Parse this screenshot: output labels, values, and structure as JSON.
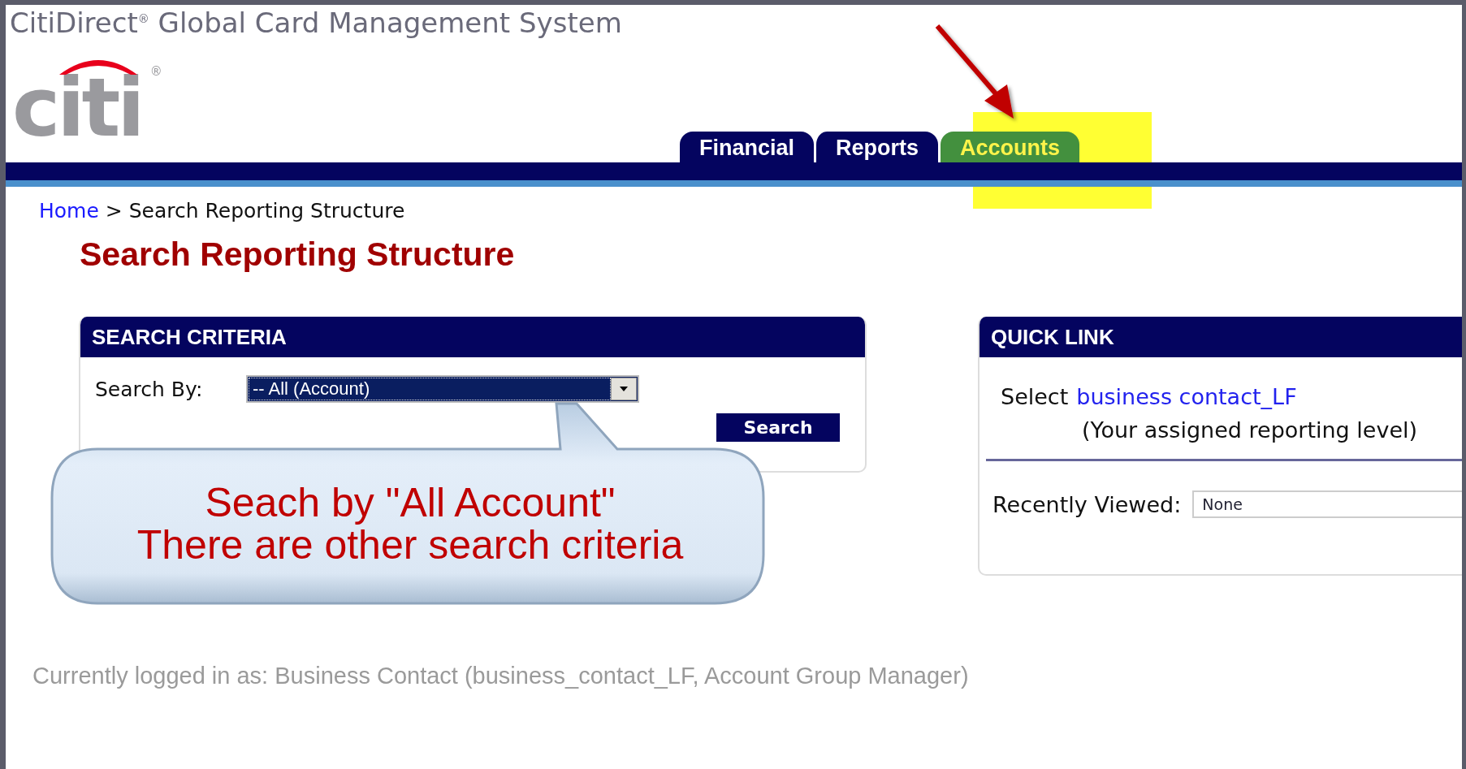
{
  "window": {
    "title": "CitiDirect$^{®}$ Global Card Management System"
  },
  "logo": {
    "text": "citi",
    "mark": "®"
  },
  "tabs": [
    {
      "label": "Financial",
      "selected": false
    },
    {
      "label": "Reports",
      "selected": false
    },
    {
      "label": "Accounts",
      "selected": true
    }
  ],
  "breadcrumb": {
    "link": "Home",
    "separator": ">",
    "current": "Search Reporting Structure"
  },
  "heading": "Search Reporting Structure",
  "search_panel": {
    "title": "SEARCH CRITERIA",
    "label": "Search By:",
    "value": "-- All (Account)",
    "button": "Search"
  },
  "quick_link": {
    "title": "QUICK LINK",
    "prefix": "Select",
    "link": "business contact_LF",
    "note": "(Your assigned reporting level)",
    "recent_label": "Recently Viewed:",
    "recent_value": "None"
  },
  "callout": {
    "lines": [
      "Seach by \"All Account\"",
      "There are other search criteria"
    ]
  },
  "status_bar": "Currently logged in as: Business Contact (business_contact_LF, Account Group Manager)"
}
